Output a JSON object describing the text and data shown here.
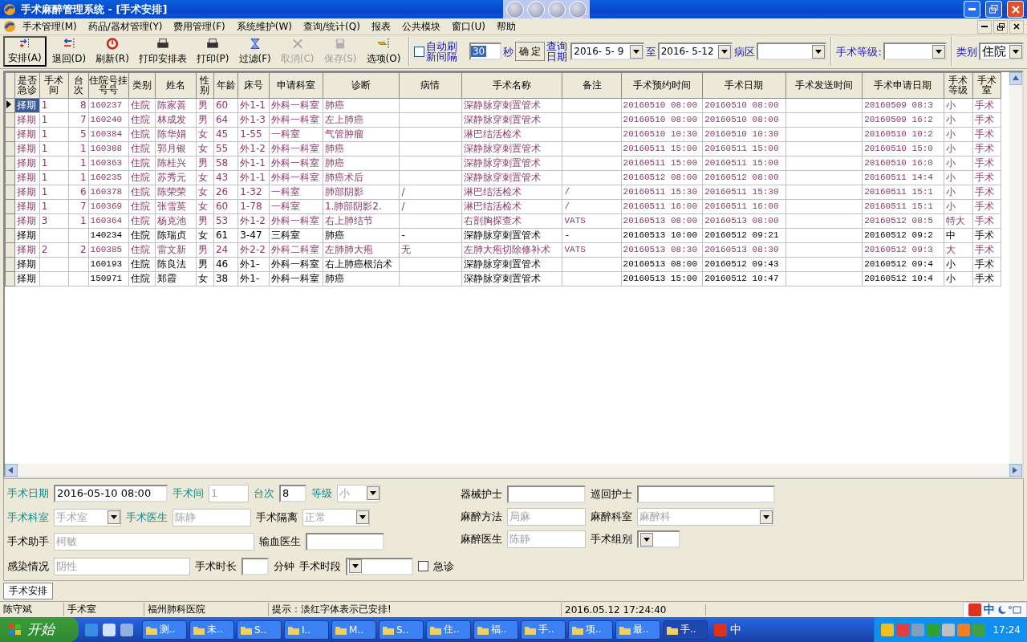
{
  "window": {
    "title": "手术麻醉管理系统 - [手术安排]"
  },
  "menu": [
    "手术管理(M)",
    "药品/器材管理(Y)",
    "费用管理(F)",
    "系统维护(W)",
    "查询/统计(Q)",
    "报表",
    "公共模块",
    "窗口(U)",
    "帮助"
  ],
  "toolbar": [
    {
      "label": "安排(A)",
      "kind": "arrange",
      "disabled": false,
      "selected": true
    },
    {
      "label": "退回(D)",
      "kind": "back",
      "disabled": false,
      "selected": false
    },
    {
      "label": "刷新(R)",
      "kind": "refresh",
      "disabled": false,
      "selected": false
    },
    {
      "label": "打印安排表",
      "kind": "print",
      "disabled": false,
      "selected": false
    },
    {
      "label": "打印(P)",
      "kind": "print",
      "disabled": false,
      "selected": false
    },
    {
      "label": "过滤(F)",
      "kind": "filter",
      "disabled": false,
      "selected": false
    },
    {
      "label": "取消(C)",
      "kind": "cancel",
      "disabled": true,
      "selected": false
    },
    {
      "label": "保存(S)",
      "kind": "save",
      "disabled": true,
      "selected": false
    },
    {
      "label": "选项(O)",
      "kind": "options",
      "disabled": false,
      "selected": false
    }
  ],
  "query": {
    "auto_refresh": {
      "label": "自动刷新间隔",
      "checked": false
    },
    "interval": "30",
    "unit": "秒",
    "confirm": "确 定",
    "date_label": "查询日期",
    "date_from": "2016- 5- 9",
    "to": "至",
    "date_to": "2016- 5-12",
    "ward_label": "病区",
    "grade_label": "手术等级:",
    "type_label": "类别",
    "type_value": "住院"
  },
  "table": {
    "columns": [
      "是否急诊",
      "手术间",
      "台次",
      "住院号挂号号",
      "类别",
      "姓名",
      "性别",
      "年龄",
      "床号",
      "申请科室",
      "诊断",
      "病情",
      "手术名称",
      "备注",
      "手术预约时间",
      "手术日期",
      "手术发送时间",
      "手术申请日期",
      "手术等级",
      "手术室"
    ],
    "rows": [
      {
        "selected": true,
        "arranged": true,
        "cells": [
          "择期",
          "1",
          "8",
          "160237",
          "住院",
          "陈家善",
          "男",
          "60",
          "外1-1",
          "外科一科室",
          "肺癌",
          "",
          "深静脉穿刺置管术",
          "",
          "20160510 08:00",
          "20160510 08:00",
          "",
          "20160509 08:3",
          "小",
          "手术"
        ]
      },
      {
        "selected": false,
        "arranged": true,
        "cells": [
          "择期",
          "1",
          "7",
          "160240",
          "住院",
          "林成发",
          "男",
          "64",
          "外1-3",
          "外科一科室",
          "左上肺癌",
          "",
          "深静脉穿刺置管术",
          "",
          "20160510 08:00",
          "20160510 08:00",
          "",
          "20160509 16:2",
          "小",
          "手术"
        ]
      },
      {
        "selected": false,
        "arranged": true,
        "cells": [
          "择期",
          "1",
          "5",
          "160384",
          "住院",
          "陈华娟",
          "女",
          "45",
          "1-55",
          "一科室",
          "气管肿瘤",
          "",
          "淋巴结活检术",
          "",
          "20160510 10:30",
          "20160510 10:30",
          "",
          "20160510 10:2",
          "小",
          "手术"
        ]
      },
      {
        "selected": false,
        "arranged": true,
        "cells": [
          "择期",
          "1",
          "1",
          "160388",
          "住院",
          "郭月银",
          "女",
          "55",
          "外1-2",
          "外科一科室",
          "肺癌",
          "",
          "深静脉穿刺置管术",
          "",
          "20160511 15:00",
          "20160511 15:00",
          "",
          "20160510 15:0",
          "小",
          "手术"
        ]
      },
      {
        "selected": false,
        "arranged": true,
        "cells": [
          "择期",
          "1",
          "1",
          "160363",
          "住院",
          "陈桂兴",
          "男",
          "58",
          "外1-1",
          "外科一科室",
          "肺癌",
          "",
          "深静脉穿刺置管术",
          "",
          "20160511 15:00",
          "20160511 15:00",
          "",
          "20160510 16:0",
          "小",
          "手术"
        ]
      },
      {
        "selected": false,
        "arranged": true,
        "cells": [
          "择期",
          "1",
          "1",
          "160235",
          "住院",
          "苏秀元",
          "女",
          "43",
          "外1-1",
          "外科一科室",
          "肺癌术后",
          "",
          "深静脉穿刺置管术",
          "",
          "20160512 08:00",
          "20160512 08:00",
          "",
          "20160511 14:4",
          "小",
          "手术"
        ]
      },
      {
        "selected": false,
        "arranged": true,
        "cells": [
          "择期",
          "1",
          "6",
          "160378",
          "住院",
          "陈荣荣",
          "女",
          "26",
          "1-32",
          "一科室",
          "肺部阴影",
          "/",
          "淋巴结活检术",
          "/",
          "20160511 15:30",
          "20160511 15:30",
          "",
          "20160511 15:1",
          "小",
          "手术"
        ]
      },
      {
        "selected": false,
        "arranged": true,
        "cells": [
          "择期",
          "1",
          "7",
          "160369",
          "住院",
          "张雪英",
          "女",
          "60",
          "1-78",
          "一科室",
          "1.肺部阴影2.",
          "/",
          "淋巴结活检术",
          "/",
          "20160511 16:00",
          "20160511 16:00",
          "",
          "20160511 15:1",
          "小",
          "手术"
        ]
      },
      {
        "selected": false,
        "arranged": true,
        "cells": [
          "择期",
          "3",
          "1",
          "160364",
          "住院",
          "杨克池",
          "男",
          "53",
          "外1-2",
          "外科一科室",
          "右上肺结节",
          "",
          "右剖胸探查术",
          "VATS",
          "20160513 08:00",
          "20160513 08:00",
          "",
          "20160512 08:5",
          "特大",
          "手术"
        ]
      },
      {
        "selected": false,
        "arranged": false,
        "cells": [
          "择期",
          "",
          "",
          "140234",
          "住院",
          "陈瑞贞",
          "女",
          "61",
          "3-47",
          "三科室",
          "肺癌",
          "-",
          "深静脉穿刺置管术",
          "-",
          "20160513 10:00",
          "20160512 09:21",
          "",
          "20160512 09:2",
          "中",
          "手术"
        ]
      },
      {
        "selected": false,
        "arranged": true,
        "cells": [
          "择期",
          "2",
          "2",
          "160385",
          "住院",
          "雷文新",
          "男",
          "24",
          "外2-2",
          "外科二科室",
          "左肺肺大疱",
          "无",
          "左肺大疱切除修补术",
          "VATS",
          "20160513 08:30",
          "20160513 08:30",
          "",
          "20160512 09:3",
          "大",
          "手术"
        ]
      },
      {
        "selected": false,
        "arranged": false,
        "cells": [
          "择期",
          "",
          "",
          "160193",
          "住院",
          "陈良法",
          "男",
          "46",
          "外1-",
          "外科一科室",
          "右上肺癌根治术",
          "",
          "深静脉穿刺置管术",
          "",
          "20160513 08:00",
          "20160512 09:43",
          "",
          "20160512 09:4",
          "小",
          "手术"
        ]
      },
      {
        "selected": false,
        "arranged": false,
        "cells": [
          "择期",
          "",
          "",
          "150971",
          "住院",
          "郑霞",
          "女",
          "38",
          "外1-",
          "外科一科室",
          "肺癌",
          "",
          "深静脉穿刺置管术",
          "",
          "20160513 15:00",
          "20160512 10:47",
          "",
          "20160512 10:4",
          "小",
          "手术"
        ]
      }
    ]
  },
  "form": {
    "left": [
      [
        {
          "label": "手术日期",
          "kind": "wide",
          "value": "2016-05-10 08:00",
          "highlighted": true,
          "disabled": false
        },
        {
          "label": "手术间",
          "kind": "short",
          "value": "1",
          "highlighted": true,
          "disabled": true
        },
        {
          "label": "台次",
          "kind": "tiny",
          "value": "8",
          "highlighted": true,
          "disabled": false
        },
        {
          "label": "等级",
          "kind": "smallselect",
          "value": "小",
          "highlighted": true,
          "disabled": true
        }
      ],
      [
        {
          "label": "手术科室",
          "kind": "select",
          "value": "手术室",
          "highlighted": true,
          "disabled": true
        },
        {
          "label": "手术医生",
          "kind": "text",
          "value": "陈静",
          "highlighted": true,
          "disabled": true
        },
        {
          "label": "手术隔离",
          "kind": "select",
          "value": "正常",
          "highlighted": false,
          "disabled": true
        }
      ],
      [
        {
          "label": "手术助手",
          "kind": "huge",
          "value": "柯敏",
          "highlighted": false,
          "disabled": true
        },
        {
          "label": "输血医生",
          "kind": "text",
          "highlighted": false,
          "disabled": false
        }
      ],
      [
        {
          "label": "感染情况",
          "kind": "big",
          "value": "阴性",
          "highlighted": false,
          "disabled": true
        },
        {
          "label": "手术时长",
          "kind": "tiny",
          "unit": "分钟",
          "highlighted": false,
          "disabled": false
        },
        {
          "label": "手术时段",
          "kind": "select",
          "highlighted": false,
          "disabled": false
        },
        {
          "label": "急诊",
          "kind": "check",
          "checked": false,
          "highlighted": false
        }
      ]
    ],
    "right": [
      [
        {
          "label": "器械护士",
          "kind": "text",
          "highlighted": false,
          "disabled": false
        },
        {
          "label": "巡回护士",
          "kind": "long",
          "highlighted": false,
          "disabled": false
        }
      ],
      [
        {
          "label": "麻醉方法",
          "kind": "text",
          "value": "局麻",
          "highlighted": false,
          "disabled": true
        },
        {
          "label": "麻醉科室",
          "kind": "longselect",
          "value": "麻醉科",
          "highlighted": false,
          "disabled": true
        }
      ],
      [
        {
          "label": "麻醉医生",
          "kind": "text",
          "value": "陈静",
          "highlighted": false,
          "disabled": true
        },
        {
          "label": "手术组别",
          "kind": "smallselect",
          "highlighted": false,
          "disabled": false
        }
      ]
    ]
  },
  "tabs": [
    {
      "label": "手术安排",
      "selected": true
    }
  ],
  "status_bar": [
    "陈守斌",
    "手术室",
    "福州肺科医院",
    "提示：淡红字体表示已安排!",
    "2016.05.12 17:24:40"
  ],
  "taskbar": {
    "start": "开始",
    "tasks": [
      {
        "label": "测..",
        "selected": false
      },
      {
        "label": "未..",
        "selected": false
      },
      {
        "label": "S..",
        "selected": false
      },
      {
        "label": "I..",
        "selected": false
      },
      {
        "label": "M..",
        "selected": false
      },
      {
        "label": "S..",
        "selected": false
      },
      {
        "label": "住..",
        "selected": false
      },
      {
        "label": "福..",
        "selected": false
      },
      {
        "label": "手..",
        "selected": false
      },
      {
        "label": "项..",
        "selected": false
      },
      {
        "label": "最..",
        "selected": false
      },
      {
        "label": "手..",
        "selected": true
      }
    ],
    "ime": "中",
    "tray_ime": "中",
    "clock": "17:24"
  }
}
